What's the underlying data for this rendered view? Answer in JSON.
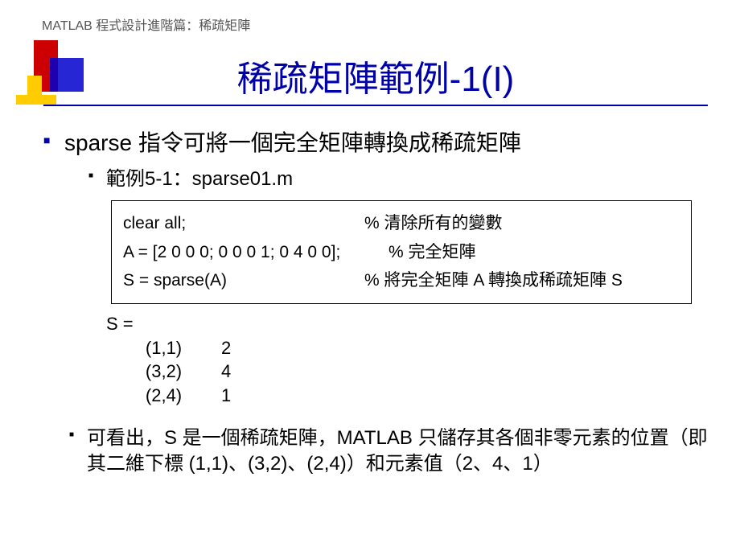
{
  "breadcrumb": "MATLAB 程式設計進階篇：稀疏矩陣",
  "title": "稀疏矩陣範例-1(I)",
  "bullet1": "sparse 指令可將一個完全矩陣轉換成稀疏矩陣",
  "bullet1_sub": "範例5-1：sparse01.m",
  "code": {
    "line1_left": "clear all;",
    "line1_right": "% 清除所有的變數",
    "line2_left": "A = [2 0 0 0; 0 0 0 1; 0 4 0 0];",
    "line2_right": "% 完全矩陣",
    "line3_left": "S = sparse(A)",
    "line3_right": "% 將完全矩陣 A 轉換成稀疏矩陣 S"
  },
  "output": "S =\n        (1,1)        2\n        (3,2)        4\n        (2,4)        1",
  "bullet2": "可看出，S 是一個稀疏矩陣，MATLAB 只儲存其各個非零元素的位置（即其二維下標 (1,1)、(3,2)、(2,4)）和元素值（2、4、1）"
}
